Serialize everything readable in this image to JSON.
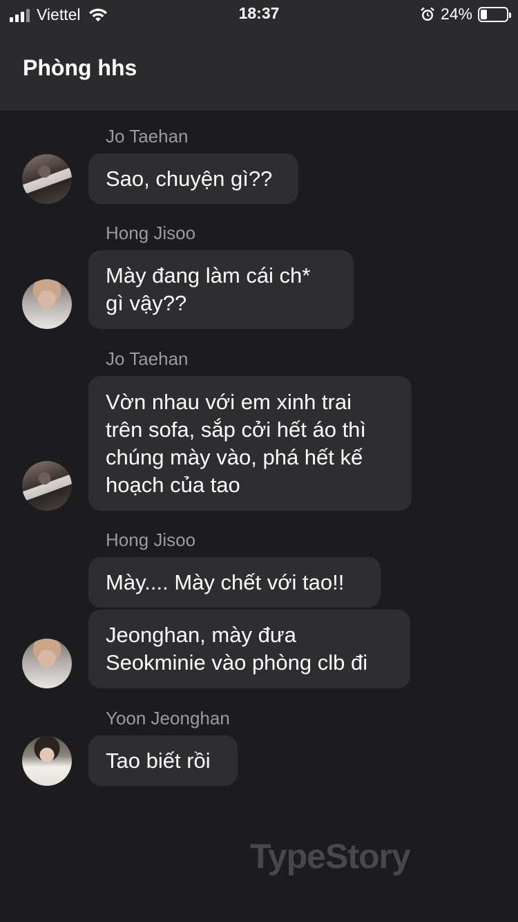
{
  "status_bar": {
    "carrier": "Viettel",
    "time": "18:37",
    "battery_percent": "24%",
    "battery_level": 0.24,
    "signal_bars": 3
  },
  "header": {
    "title": "Phòng hhs"
  },
  "messages": [
    {
      "sender": "Jo Taehan",
      "avatar": "avatar-jo-taehan",
      "text": "Sao, chuyện gì??"
    },
    {
      "sender": "Hong Jisoo",
      "avatar": "avatar-hong-jisoo",
      "lines": [
        "Mày đang làm cái ch*",
        "gì vậy??"
      ]
    },
    {
      "sender": "Jo Taehan",
      "avatar": "avatar-jo-taehan",
      "lines": [
        "Vờn nhau với em xinh trai",
        "trên sofa, sắp cởi hết áo thì",
        "chúng mày vào, phá hết kế",
        "hoạch của tao"
      ]
    },
    {
      "sender": "Hong Jisoo",
      "avatar": "avatar-hong-jisoo",
      "text": "Mày.... Mày chết với tao!!"
    },
    {
      "sender": "Hong Jisoo",
      "avatar": "avatar-hong-jisoo",
      "lines": [
        "Jeonghan, mày đưa",
        "Seokminie vào phòng clb đi"
      ]
    },
    {
      "sender": "Yoon Jeonghan",
      "avatar": "avatar-yoon-jeonghan",
      "text": "Tao biết rồi"
    }
  ],
  "watermark": "TypeStory"
}
